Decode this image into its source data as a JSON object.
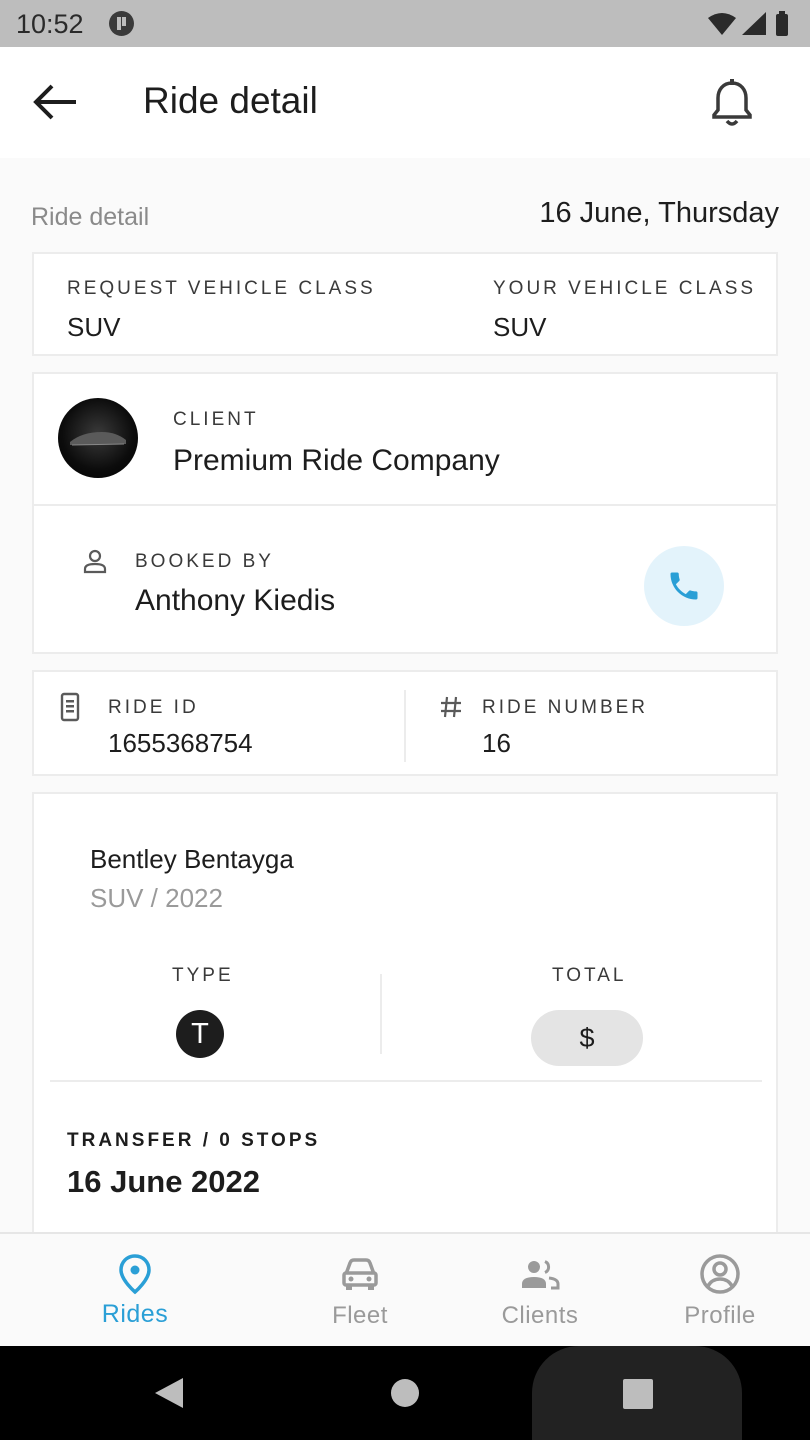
{
  "status_bar": {
    "time": "10:52",
    "icons": [
      "app-icon",
      "wifi-icon",
      "signal-icon",
      "battery-icon"
    ]
  },
  "app_bar": {
    "title": "Ride detail",
    "back_icon": "arrow-back-icon",
    "notification_icon": "bell-icon"
  },
  "summary": {
    "section_label": "Ride detail",
    "date": "16 June, Thursday"
  },
  "vehicle_class": {
    "request_label": "REQUEST VEHICLE CLASS",
    "request_value": "SUV",
    "yours_label": "YOUR VEHICLE CLASS",
    "yours_value": "SUV"
  },
  "client": {
    "label": "CLIENT",
    "name": "Premium Ride Company",
    "booked_by_label": "BOOKED BY",
    "booked_by_name": "Anthony Kiedis",
    "call_icon": "phone-icon"
  },
  "ids": {
    "ride_id_label": "RIDE ID",
    "ride_id": "1655368754",
    "ride_number_label": "RIDE NUMBER",
    "ride_number": "16"
  },
  "vehicle": {
    "name": "Bentley Bentayga",
    "subtitle": "SUV / 2022",
    "type_label": "TYPE",
    "type_badge": "T",
    "total_label": "TOTAL",
    "total_value": "$",
    "transfer_label": "TRANSFER / 0 STOPS",
    "transfer_date": "16 June 2022"
  },
  "bottom_nav": {
    "items": [
      {
        "label": "Rides",
        "icon": "location-pin-icon",
        "active": true
      },
      {
        "label": "Fleet",
        "icon": "car-icon",
        "active": false
      },
      {
        "label": "Clients",
        "icon": "people-icon",
        "active": false
      },
      {
        "label": "Profile",
        "icon": "account-circle-icon",
        "active": false
      }
    ]
  },
  "colors": {
    "accent": "#2a9fd6",
    "call_bg": "#e3f3fb",
    "text": "#1d1d1d",
    "muted": "#8a8a8a"
  }
}
